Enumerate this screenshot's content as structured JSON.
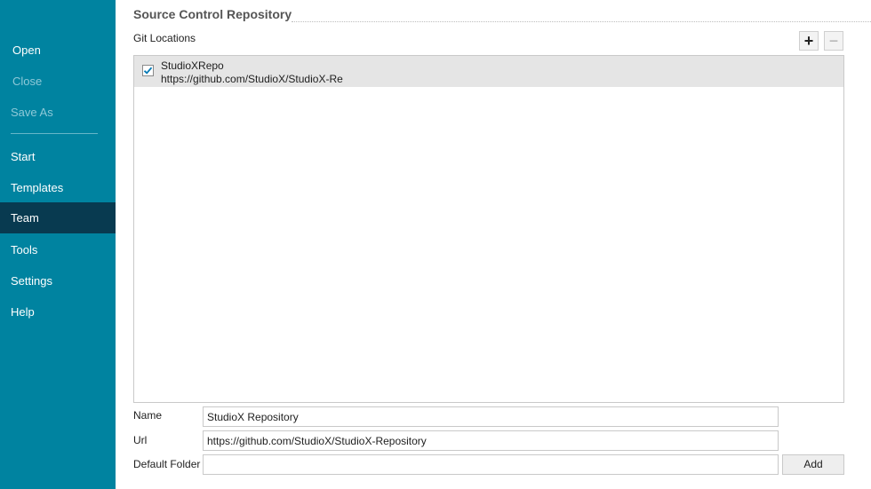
{
  "sidebar": {
    "file_items": [
      {
        "label": "Open",
        "enabled": true
      },
      {
        "label": "Close",
        "enabled": false
      },
      {
        "label": "Save As",
        "enabled": false
      }
    ],
    "nav_items": [
      {
        "label": "Start",
        "active": false
      },
      {
        "label": "Templates",
        "active": false
      },
      {
        "label": "Team",
        "active": true
      },
      {
        "label": "Tools",
        "active": false
      },
      {
        "label": "Settings",
        "active": false
      },
      {
        "label": "Help",
        "active": false
      }
    ]
  },
  "main": {
    "section_title": "Source Control Repository",
    "git_locations_label": "Git Locations",
    "add_icon": "+",
    "remove_icon": "−",
    "repositories": [
      {
        "name": "StudioXRepo",
        "url": "https://github.com/StudioX/StudioX-Re",
        "checked": true
      }
    ],
    "form": {
      "name_label": "Name",
      "name_value": "StudioX Repository",
      "url_label": "Url",
      "url_value": "https://github.com/StudioX/StudioX-Repository",
      "folder_label": "Default Folder",
      "folder_value": "",
      "add_button": "Add"
    }
  },
  "colors": {
    "sidebar_bg": "#0083a0",
    "sidebar_active": "#083a50",
    "check_color": "#0078b4"
  }
}
